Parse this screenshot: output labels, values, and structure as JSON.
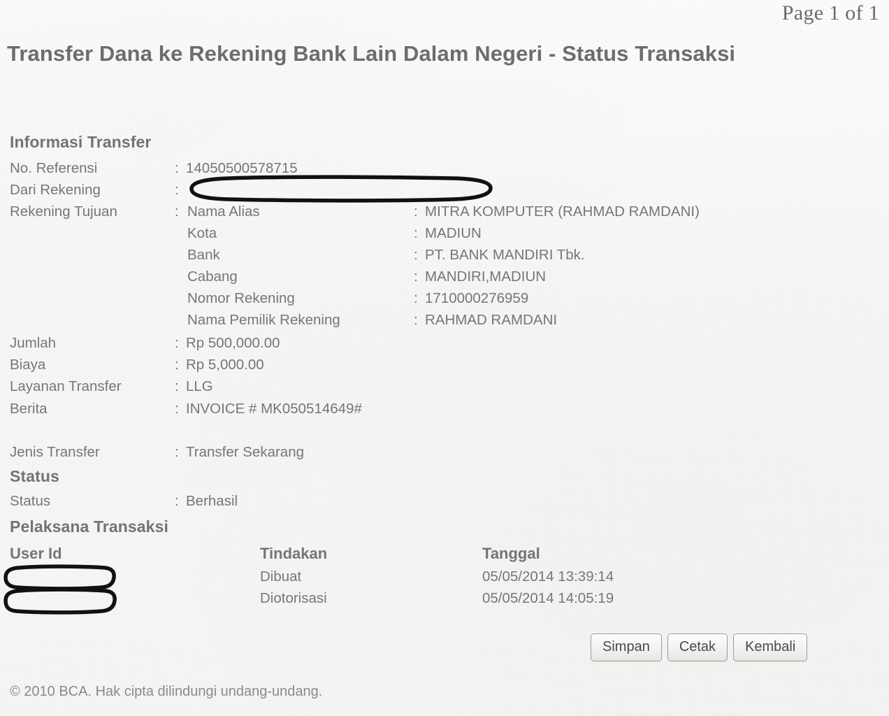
{
  "page_label": "Page 1 of 1",
  "doc_title": "Transfer Dana ke Rekening Bank Lain Dalam Negeri - Status Transaksi",
  "sections": {
    "transfer_info_heading": "Informasi Transfer",
    "status_heading": "Status",
    "executor_heading": "Pelaksana Transaksi"
  },
  "separator": ":",
  "transfer_info": {
    "reference": {
      "label": "No. Referensi",
      "value": "14050500578715"
    },
    "from_account": {
      "label": "Dari Rekening",
      "value": "",
      "redacted": true
    },
    "destination": {
      "label": "Rekening Tujuan",
      "fields": [
        {
          "label": "Nama Alias",
          "value": "MITRA KOMPUTER (RAHMAD RAMDANI)"
        },
        {
          "label": "Kota",
          "value": "MADIUN"
        },
        {
          "label": "Bank",
          "value": "PT. BANK MANDIRI Tbk."
        },
        {
          "label": "Cabang",
          "value": "MANDIRI,MADIUN"
        },
        {
          "label": "Nomor Rekening",
          "value": "1710000276959"
        },
        {
          "label": "Nama Pemilik Rekening",
          "value": "RAHMAD RAMDANI"
        }
      ]
    },
    "amount": {
      "label": "Jumlah",
      "value": "Rp 500,000.00"
    },
    "fee": {
      "label": "Biaya",
      "value": "Rp 5,000.00"
    },
    "service": {
      "label": "Layanan Transfer",
      "value": "LLG"
    },
    "note": {
      "label": "Berita",
      "value": "INVOICE # MK050514649#"
    },
    "transfer_type": {
      "label": "Jenis Transfer",
      "value": "Transfer Sekarang"
    }
  },
  "status": {
    "label": "Status",
    "value": "Berhasil"
  },
  "executor_table": {
    "columns": [
      "User Id",
      "Tindakan",
      "Tanggal"
    ],
    "rows": [
      {
        "user_id": "",
        "user_id_redacted": true,
        "action": "Dibuat",
        "timestamp": "05/05/2014 13:39:14"
      },
      {
        "user_id": "",
        "user_id_redacted": true,
        "action": "Diotorisasi",
        "timestamp": "05/05/2014 14:05:19"
      }
    ]
  },
  "buttons": {
    "save": "Simpan",
    "print": "Cetak",
    "back": "Kembali"
  },
  "footer": "© 2010 BCA. Hak cipta dilindungi undang-undang.",
  "colors": {
    "paper": "#f6f6f4",
    "text": "#767676",
    "heading": "#6f6f6f",
    "redaction_ink": "#111111",
    "button_border": "#9a9a9a"
  }
}
